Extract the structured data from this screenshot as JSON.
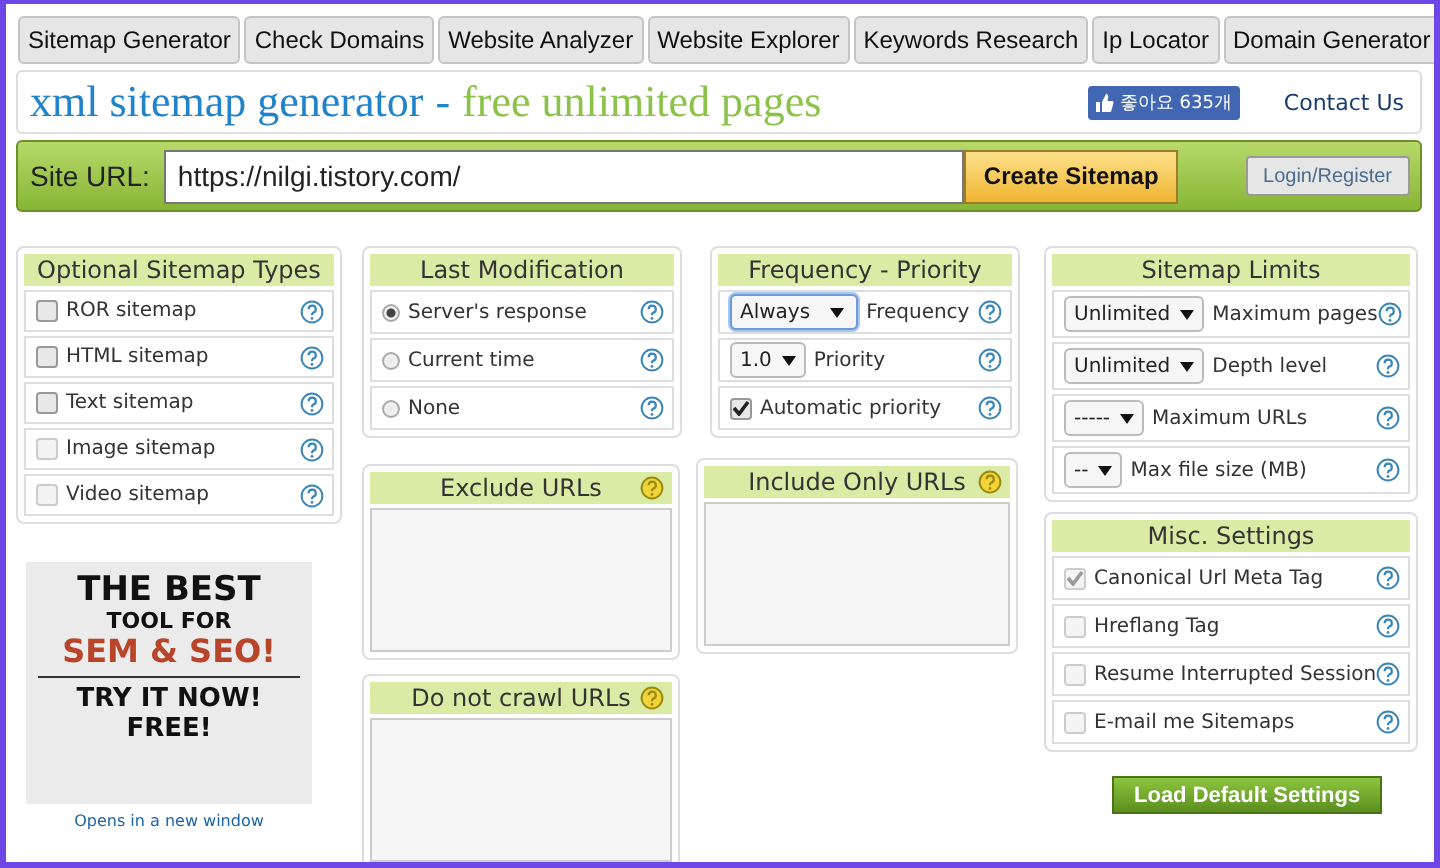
{
  "tabs": [
    {
      "label": "Sitemap Generator"
    },
    {
      "label": "Check Domains"
    },
    {
      "label": "Website Analyzer"
    },
    {
      "label": "Website Explorer"
    },
    {
      "label": "Keywords Research"
    },
    {
      "label": "Ip Locator"
    },
    {
      "label": "Domain Generator"
    }
  ],
  "header": {
    "title": "xml sitemap generator",
    "separator": "-",
    "subtitle": "free unlimited pages",
    "like_button": "좋아요 635개",
    "contact_link": "Contact Us"
  },
  "url_bar": {
    "label": "Site URL:",
    "value": "https://nilgi.tistory.com/",
    "create_button": "Create Sitemap",
    "login_button": "Login/Register"
  },
  "sitemap_types": {
    "title": "Optional Sitemap Types",
    "items": [
      {
        "label": "ROR sitemap",
        "checked": false,
        "disabled": false
      },
      {
        "label": "HTML sitemap",
        "checked": false,
        "disabled": false
      },
      {
        "label": "Text sitemap",
        "checked": false,
        "disabled": false
      },
      {
        "label": "Image sitemap",
        "checked": false,
        "disabled": true
      },
      {
        "label": "Video sitemap",
        "checked": false,
        "disabled": true
      }
    ]
  },
  "last_modification": {
    "title": "Last Modification",
    "items": [
      {
        "label": "Server's response",
        "selected": true
      },
      {
        "label": "Current time",
        "selected": false
      },
      {
        "label": "None",
        "selected": false
      }
    ]
  },
  "frequency_priority": {
    "title": "Frequency - Priority",
    "items": [
      {
        "kind": "select",
        "value": "Always",
        "label": "Frequency",
        "focused": true
      },
      {
        "kind": "select",
        "value": "1.0",
        "label": "Priority",
        "focused": false
      },
      {
        "kind": "checkbox",
        "label": "Automatic priority",
        "checked": true
      }
    ]
  },
  "sitemap_limits": {
    "title": "Sitemap Limits",
    "items": [
      {
        "value": "Unlimited",
        "label": "Maximum pages"
      },
      {
        "value": "Unlimited",
        "label": "Depth level"
      },
      {
        "value": "-----",
        "label": "Maximum URLs"
      },
      {
        "value": "--",
        "label": "Max file size (MB)"
      }
    ]
  },
  "misc_settings": {
    "title": "Misc. Settings",
    "items": [
      {
        "label": "Canonical Url Meta Tag",
        "checked": true,
        "disabled": true
      },
      {
        "label": "Hreflang Tag",
        "checked": false,
        "disabled": true
      },
      {
        "label": "Resume Interrupted Session",
        "checked": false,
        "disabled": true
      },
      {
        "label": "E-mail me Sitemaps",
        "checked": false,
        "disabled": true
      }
    ]
  },
  "exclude_urls": {
    "title": "Exclude URLs"
  },
  "include_only_urls": {
    "title": "Include Only URLs"
  },
  "do_not_crawl_urls": {
    "title": "Do not crawl URLs"
  },
  "ad": {
    "lines": [
      {
        "text": "THE BEST",
        "kind": "big"
      },
      {
        "text": "TOOL FOR",
        "kind": "small"
      },
      {
        "text": "SEM & SEO!",
        "kind": "accent"
      },
      {
        "text": "TRY IT NOW!",
        "kind": "cta"
      },
      {
        "text": "FREE!",
        "kind": "cta"
      }
    ],
    "link": "Opens in a new window"
  },
  "load_defaults_button": "Load Default Settings"
}
